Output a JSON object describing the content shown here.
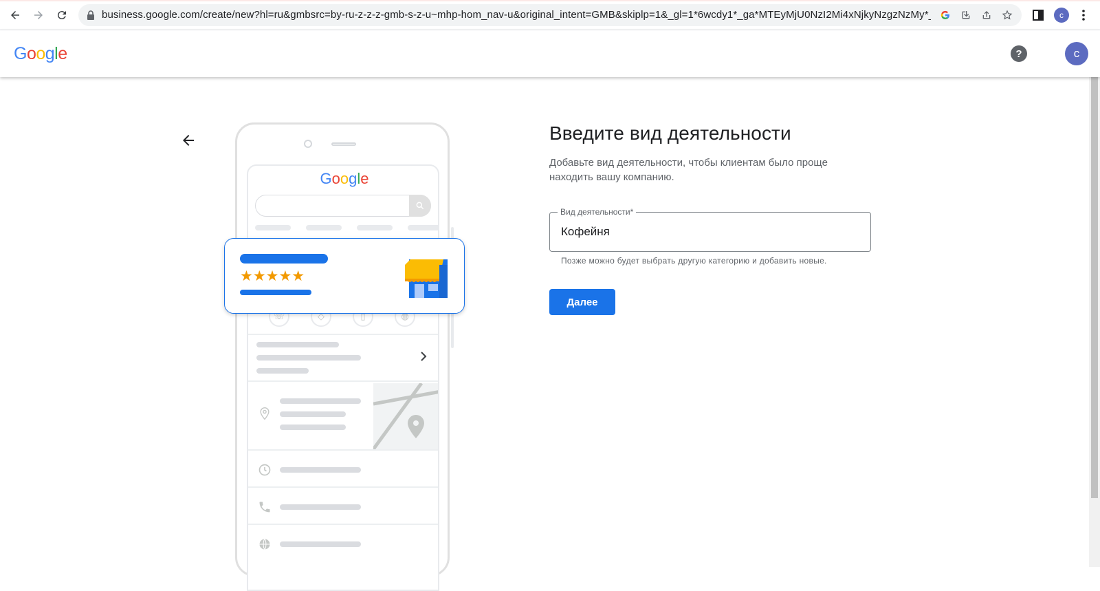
{
  "browser": {
    "url": "business.google.com/create/new?hl=ru&gmbsrc=by-ru-z-z-z-gmb-s-z-u~mhp-hom_nav-u&original_intent=GMB&skiplp=1&_gl=1*6wcdy1*_ga*MTEyMjU0NzI2Mi4xNjkyNzgzNzMy*_g...",
    "profile_initial": "c"
  },
  "header": {
    "logo_text": "Google",
    "avatar_initial": "c"
  },
  "illustration": {
    "logo_text": "Google",
    "stars": "★★★★★"
  },
  "form": {
    "title": "Введите вид деятельности",
    "subtitle": "Добавьте вид деятельности, чтобы клиентам было проще находить вашу компанию.",
    "field_label": "Вид деятельности*",
    "field_value": "Кофейня",
    "hint": "Позже можно будет выбрать другую категорию и добавить новые.",
    "next_label": "Далее"
  },
  "colors": {
    "primary": "#1a73e8",
    "star": "#f29900",
    "avatar": "#5c6bc0"
  }
}
